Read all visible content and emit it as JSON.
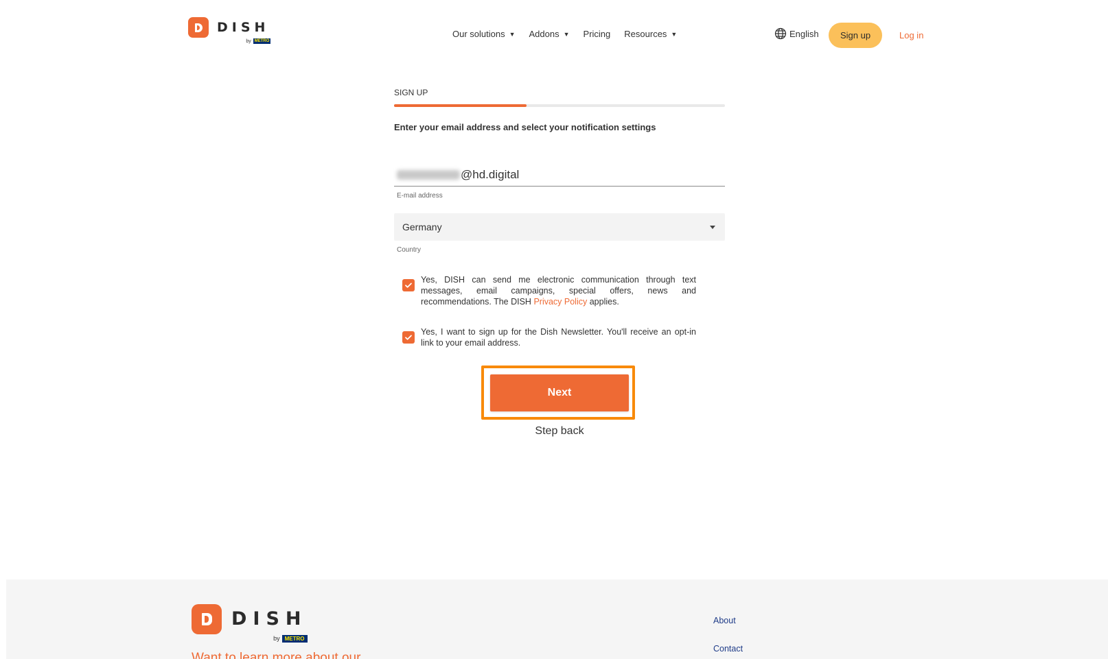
{
  "brand": {
    "name": "DISH",
    "by": "by",
    "metro": "METRO",
    "color": "#ee6a34"
  },
  "header": {
    "nav": [
      {
        "label": "Our solutions",
        "has_dropdown": true
      },
      {
        "label": "Addons",
        "has_dropdown": true
      },
      {
        "label": "Pricing",
        "has_dropdown": false
      },
      {
        "label": "Resources",
        "has_dropdown": true
      }
    ],
    "dropdown_glyph": "▼",
    "language": {
      "label": "English",
      "icon": "globe-icon"
    },
    "signup_label": "Sign up",
    "login_label": "Log in"
  },
  "form": {
    "step_label": "SIGN UP",
    "progress": 0.4,
    "instruction": "Enter your email address and select your notification settings",
    "email": {
      "visible_value": "@hd.digital",
      "local_part_blurred": true,
      "label": "E-mail address"
    },
    "country": {
      "value": "Germany",
      "label": "Country"
    },
    "consents": [
      {
        "checked": true,
        "text_before": "Yes, DISH can send me electronic communication through text messages, email campaigns, special offers, news and recommendations. The DISH ",
        "link": "Privacy Policy",
        "text_after": " applies."
      },
      {
        "checked": true,
        "text_before": "Yes, I want to sign up for the Dish Newsletter. You'll receive an opt-in link to your email address."
      }
    ],
    "next_label": "Next",
    "step_back_label": "Step back",
    "highlight_color": "#f88a0a"
  },
  "footer": {
    "tagline": "Want to learn more about our",
    "links": [
      "About",
      "Contact"
    ]
  }
}
